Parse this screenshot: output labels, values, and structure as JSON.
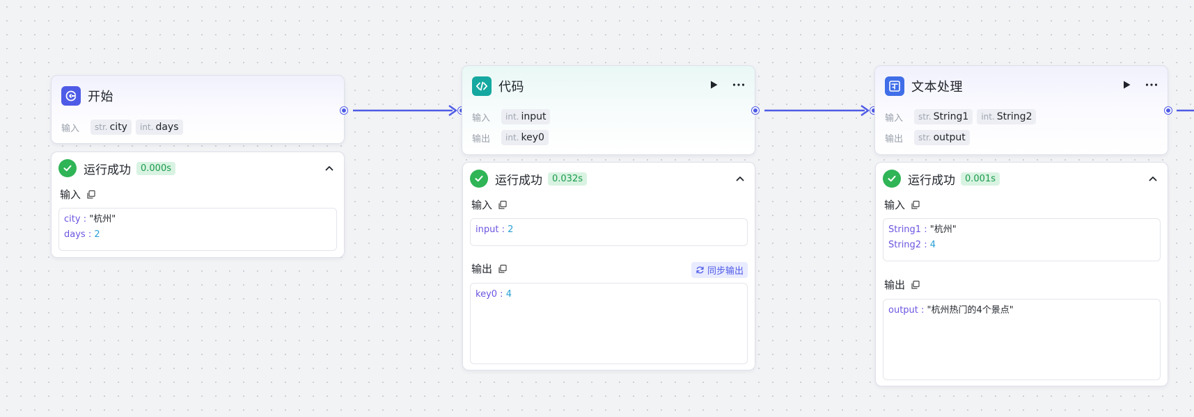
{
  "colors": {
    "accent": "#4e5be6",
    "success": "#2fb456",
    "code_icon": "#14a8a0"
  },
  "nodes": {
    "start": {
      "title": "开始",
      "icon": "start-icon",
      "input_label": "输入",
      "inputs": [
        {
          "type": "str.",
          "name": "city"
        },
        {
          "type": "int.",
          "name": "days"
        }
      ]
    },
    "code": {
      "title": "代码",
      "icon": "code-icon",
      "input_label": "输入",
      "output_label": "输出",
      "inputs": [
        {
          "type": "int.",
          "name": "input"
        }
      ],
      "outputs": [
        {
          "type": "int.",
          "name": "key0"
        }
      ]
    },
    "text": {
      "title": "文本处理",
      "icon": "text-process-icon",
      "input_label": "输入",
      "output_label": "输出",
      "inputs": [
        {
          "type": "str.",
          "name": "String1"
        },
        {
          "type": "int.",
          "name": "String2"
        }
      ],
      "outputs": [
        {
          "type": "str.",
          "name": "output"
        }
      ]
    }
  },
  "results": {
    "start": {
      "status": "运行成功",
      "time": "0.000s",
      "input_label": "输入",
      "inputs": [
        {
          "key": "city",
          "value": "\"杭州\""
        },
        {
          "key": "days",
          "value": "2"
        }
      ]
    },
    "code": {
      "status": "运行成功",
      "time": "0.032s",
      "input_label": "输入",
      "inputs": [
        {
          "key": "input",
          "value": "2"
        }
      ],
      "output_label": "输出",
      "sync_label": "同步输出",
      "outputs": [
        {
          "key": "key0",
          "value": "4"
        }
      ]
    },
    "text": {
      "status": "运行成功",
      "time": "0.001s",
      "input_label": "输入",
      "inputs": [
        {
          "key": "String1",
          "value": "\"杭州\""
        },
        {
          "key": "String2",
          "value": "4"
        }
      ],
      "output_label": "输出",
      "outputs": [
        {
          "key": "output",
          "value": "\"杭州热门的4个景点\""
        }
      ]
    }
  },
  "kv_separator": " : "
}
